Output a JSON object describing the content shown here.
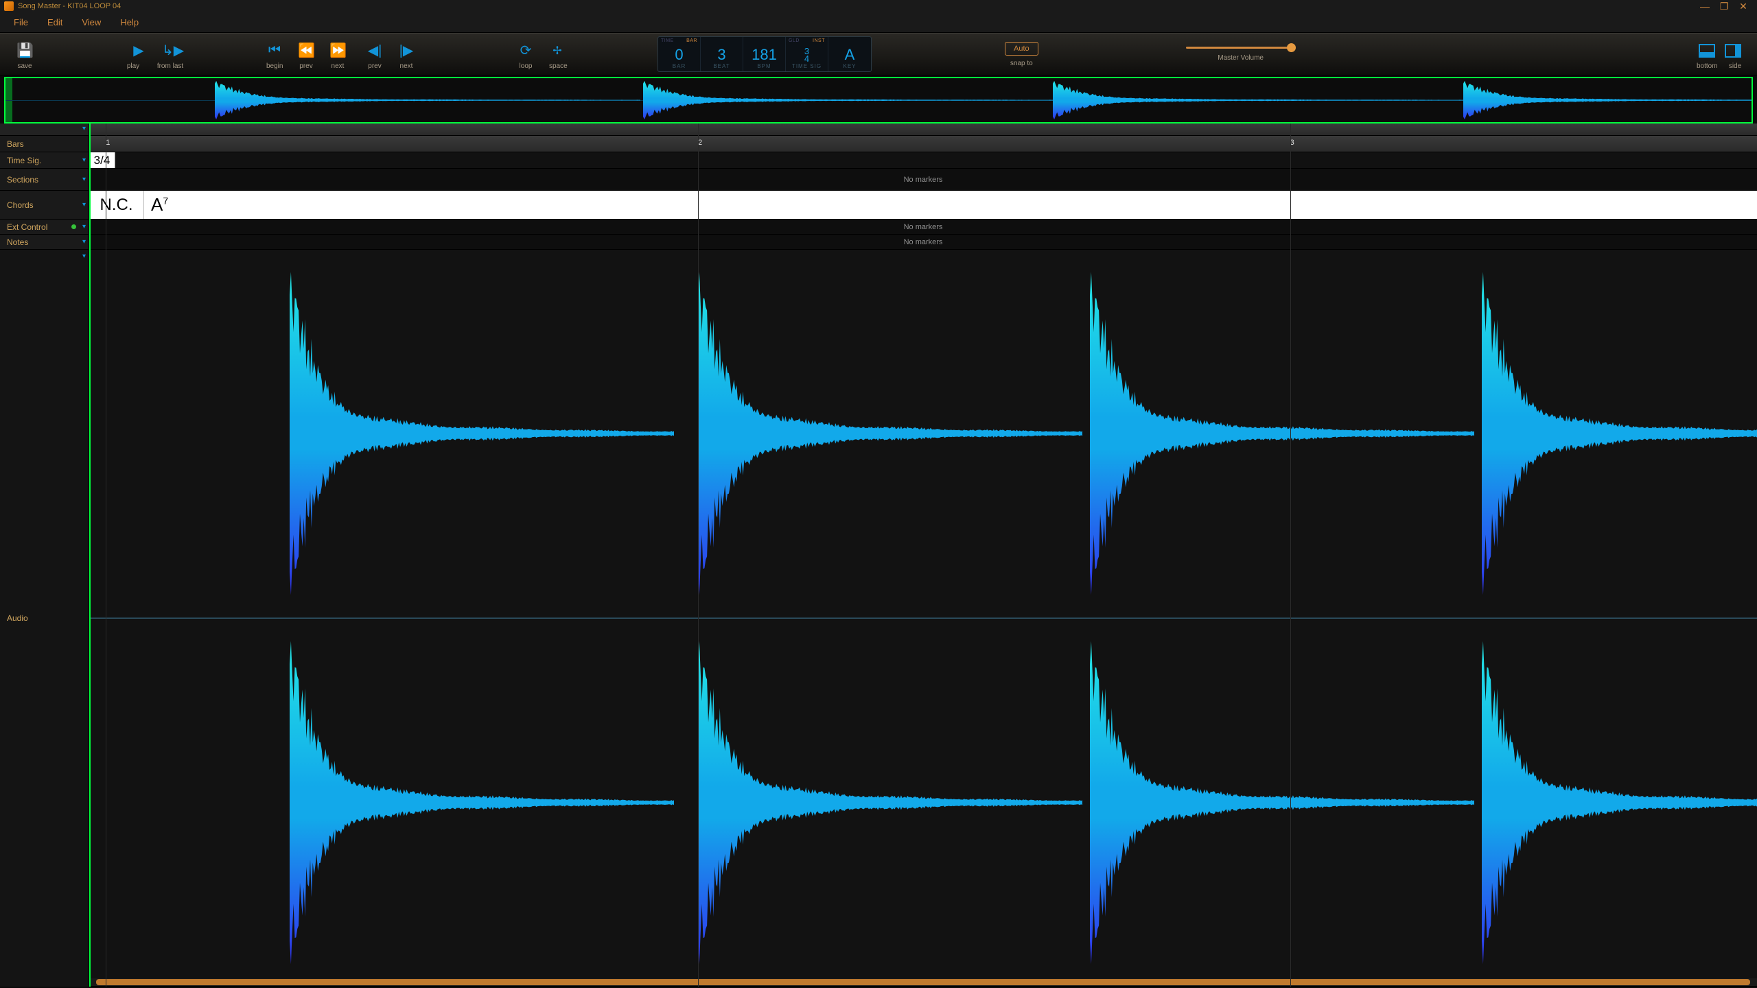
{
  "titlebar": {
    "app": "Song Master",
    "file": "KIT04 LOOP 04"
  },
  "menu": {
    "file": "File",
    "edit": "Edit",
    "view": "View",
    "help": "Help"
  },
  "toolbar": {
    "save": "save",
    "play": "play",
    "fromlast": "from last",
    "begin": "begin",
    "prev1": "prev",
    "next1": "next",
    "prev2": "prev",
    "next2": "next",
    "loop": "loop",
    "space": "space",
    "auto_btn": "Auto",
    "snapto": "snap to",
    "volume_label": "Master Volume",
    "layout_bottom": "bottom",
    "layout_side": "side"
  },
  "lcd": {
    "time_lab": "TIME",
    "bar_lab": "BAR",
    "bar_val": "0",
    "bar_txt": "BAR",
    "beat_val": "3",
    "beat_txt": "BEAT",
    "bpm_val": "181",
    "bpm_txt": "BPM",
    "ts_top": "3",
    "ts_bot": "4",
    "ts_txt": "TIME SIG",
    "gld": "GLD",
    "inst": "INST",
    "key_val": "A",
    "key_txt": "KEY"
  },
  "trackheads": {
    "bars": "Bars",
    "timesig": "Time Sig.",
    "sections": "Sections",
    "chords": "Chords",
    "ext": "Ext Control",
    "notes": "Notes",
    "audio": "Audio"
  },
  "ruler": {
    "m1": "1",
    "m2": "2",
    "m3": "3"
  },
  "timesig_cell": "3/4",
  "no_markers": "No markers",
  "chords": {
    "nc": "N.C.",
    "a7_base": "A",
    "a7_sup": "7"
  },
  "bar_positions_pct": [
    1.0,
    36.5,
    72.0
  ],
  "burst_positions_pct": [
    12.0,
    36.5,
    60.0,
    83.5
  ],
  "colors": {
    "accent": "#d0883e",
    "blue": "#1294d8",
    "green": "#00ff3c"
  }
}
